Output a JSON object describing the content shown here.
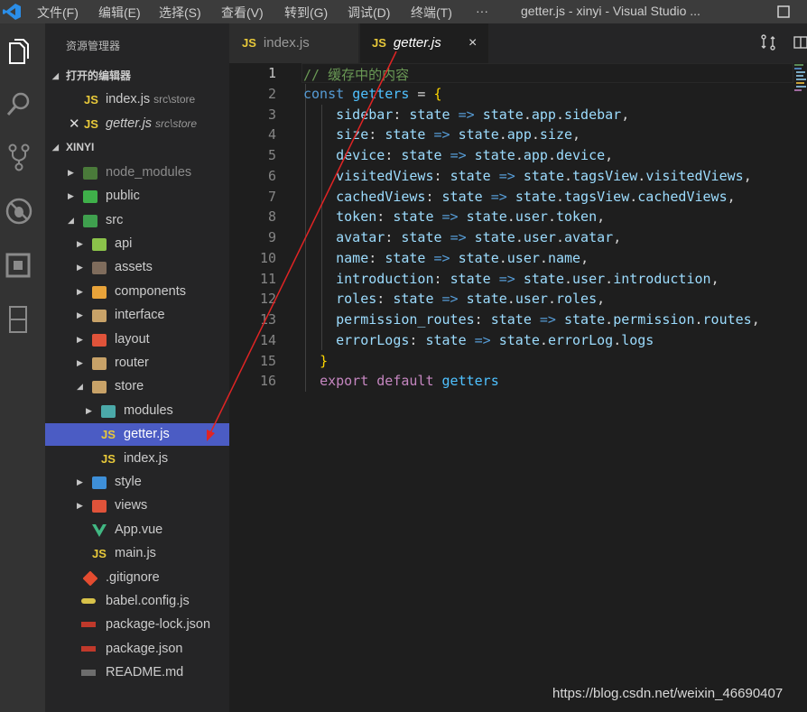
{
  "titlebar": {
    "menu": [
      "文件(F)",
      "编辑(E)",
      "选择(S)",
      "查看(V)",
      "转到(G)",
      "调试(D)",
      "终端(T)",
      "···"
    ],
    "window_title": "getter.js - xinyi - Visual Studio ..."
  },
  "activitybar": {
    "icons": [
      "explorer-icon",
      "search-icon",
      "source-control-icon",
      "debug-icon",
      "extensions-icon",
      "remote-explorer-icon"
    ]
  },
  "sidebar": {
    "title": "资源管理器",
    "open_editors": {
      "header": "打开的编辑器",
      "items": [
        {
          "name": "index.js",
          "path": "src\\store"
        },
        {
          "name": "getter.js",
          "path": "src\\store"
        }
      ]
    },
    "workspace": {
      "header": "XINYI",
      "tree": [
        "node_modules",
        "public",
        "src",
        "api",
        "assets",
        "components",
        "interface",
        "layout",
        "router",
        "store",
        "modules",
        "getter.js",
        "index.js",
        "style",
        "views",
        "App.vue",
        "main.js",
        ".gitignore",
        "babel.config.js",
        "package-lock.json",
        "package.json",
        "README.md"
      ]
    }
  },
  "tabs": [
    {
      "label": "index.js",
      "icon": "JS"
    },
    {
      "label": "getter.js",
      "icon": "JS",
      "close": "×"
    }
  ],
  "editor": {
    "line_numbers": [
      "1",
      "2",
      "3",
      "4",
      "5",
      "6",
      "7",
      "8",
      "9",
      "10",
      "11",
      "12",
      "13",
      "14",
      "15",
      "16"
    ],
    "lines": [
      "// 缓存中的内容",
      "const getters = {",
      "    sidebar: state => state.app.sidebar,",
      "    size: state => state.app.size,",
      "    device: state => state.app.device,",
      "    visitedViews: state => state.tagsView.visitedViews,",
      "    cachedViews: state => state.tagsView.cachedViews,",
      "    token: state => state.user.token,",
      "    avatar: state => state.user.avatar,",
      "    name: state => state.user.name,",
      "    introduction: state => state.user.introduction,",
      "    roles: state => state.user.roles,",
      "    permission_routes: state => state.permission.routes,",
      "    errorLogs: state => state.errorLog.logs",
      "  }",
      "  export default getters"
    ]
  },
  "watermark": "https://blog.csdn.net/weixin_46690407",
  "colors": {
    "accent_selection": "#4b5cc4",
    "annotation_arrow": "#e02424",
    "js_icon": "#e8c93a"
  }
}
